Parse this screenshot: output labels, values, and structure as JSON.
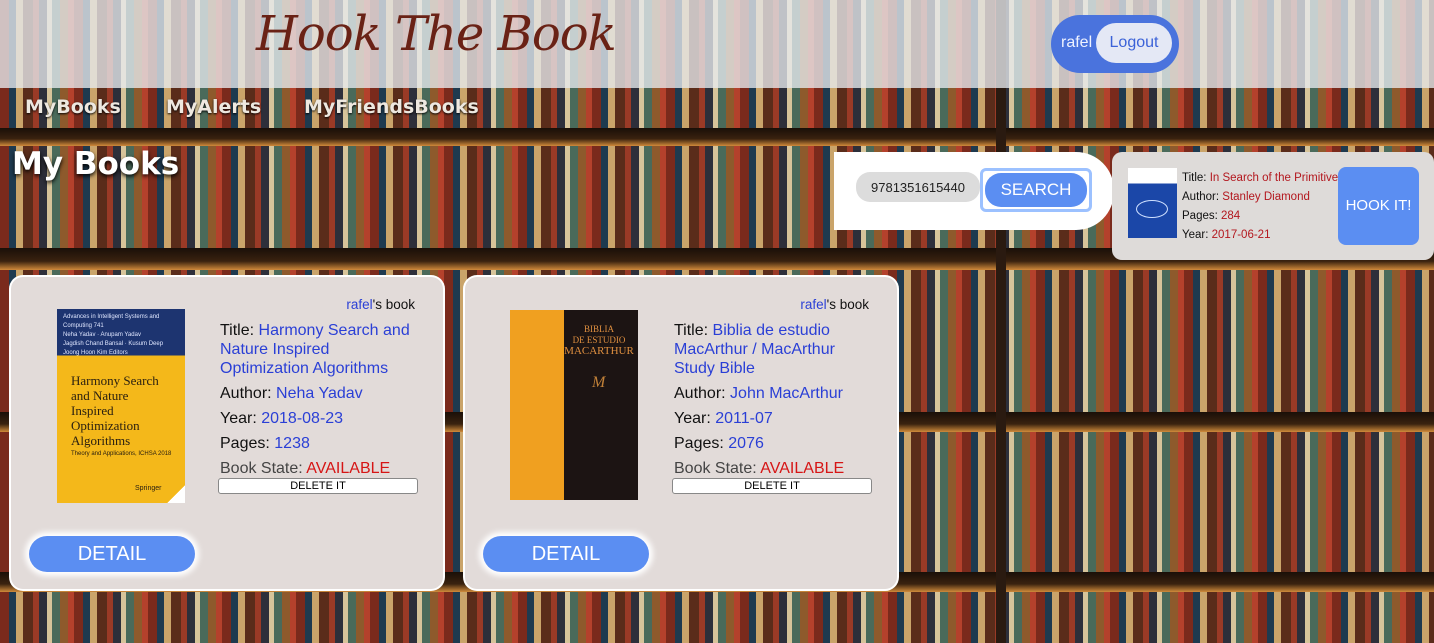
{
  "header": {
    "site_title": "Hook The Book",
    "username": "rafel",
    "logout_label": "Logout"
  },
  "nav": {
    "items": [
      {
        "label": "MyBooks"
      },
      {
        "label": "MyAlerts"
      },
      {
        "label": "MyFriendsBooks"
      }
    ]
  },
  "page_title": "My Books",
  "search": {
    "value": "9781351615440",
    "button_label": "SEARCH"
  },
  "search_result": {
    "title_label": "Title:",
    "title": "In Search of the Primitive",
    "author_label": "Author:",
    "author": "Stanley Diamond",
    "pages_label": "Pages:",
    "pages": "284",
    "year_label": "Year:",
    "year": "2017-06-21",
    "hook_label": "HOOK IT!"
  },
  "books": [
    {
      "owner": "rafel",
      "owner_suffix": "'s book",
      "title_label": "Title:",
      "title": "Harmony Search and Nature Inspired Optimization Algorithms",
      "author_label": "Author:",
      "author": "Neha Yadav",
      "year_label": "Year:",
      "year": "2018-08-23",
      "pages_label": "Pages:",
      "pages": "1238",
      "state_label": "Book State:",
      "state": "AVAILABLE",
      "delete_label": "DELETE IT",
      "detail_label": "DETAIL",
      "cover": {
        "series": "Advances in Intelligent Systems and Computing 741",
        "authors": "Neha Yadav · Anupam Yadav",
        "authors2": "Jagdish Chand Bansal · Kusum Deep",
        "authors3": "Joong Hoon Kim  Editors",
        "title": "Harmony Search and Nature Inspired Optimization Algorithms",
        "subtitle": "Theory and Applications, ICHSA 2018",
        "publisher": "Springer"
      }
    },
    {
      "owner": "rafel",
      "owner_suffix": "'s book",
      "title_label": "Title:",
      "title": "Biblia de estudio MacArthur / MacArthur Study Bible",
      "author_label": "Author:",
      "author": "John MacArthur",
      "year_label": "Year:",
      "year": "2011-07",
      "pages_label": "Pages:",
      "pages": "2076",
      "state_label": "Book State:",
      "state": "AVAILABLE",
      "delete_label": "DELETE IT",
      "detail_label": "DETAIL",
      "cover": {
        "line1": "BIBLIA",
        "line2": "DE ESTUDIO",
        "line3": "MACARTHUR",
        "sig": "M"
      }
    }
  ],
  "colors": {
    "accent_blue": "#5b8ef2",
    "link_blue": "#2a3fd6",
    "available_red": "#d61515",
    "result_red": "#b3171e",
    "title_brown": "#6a2216"
  }
}
